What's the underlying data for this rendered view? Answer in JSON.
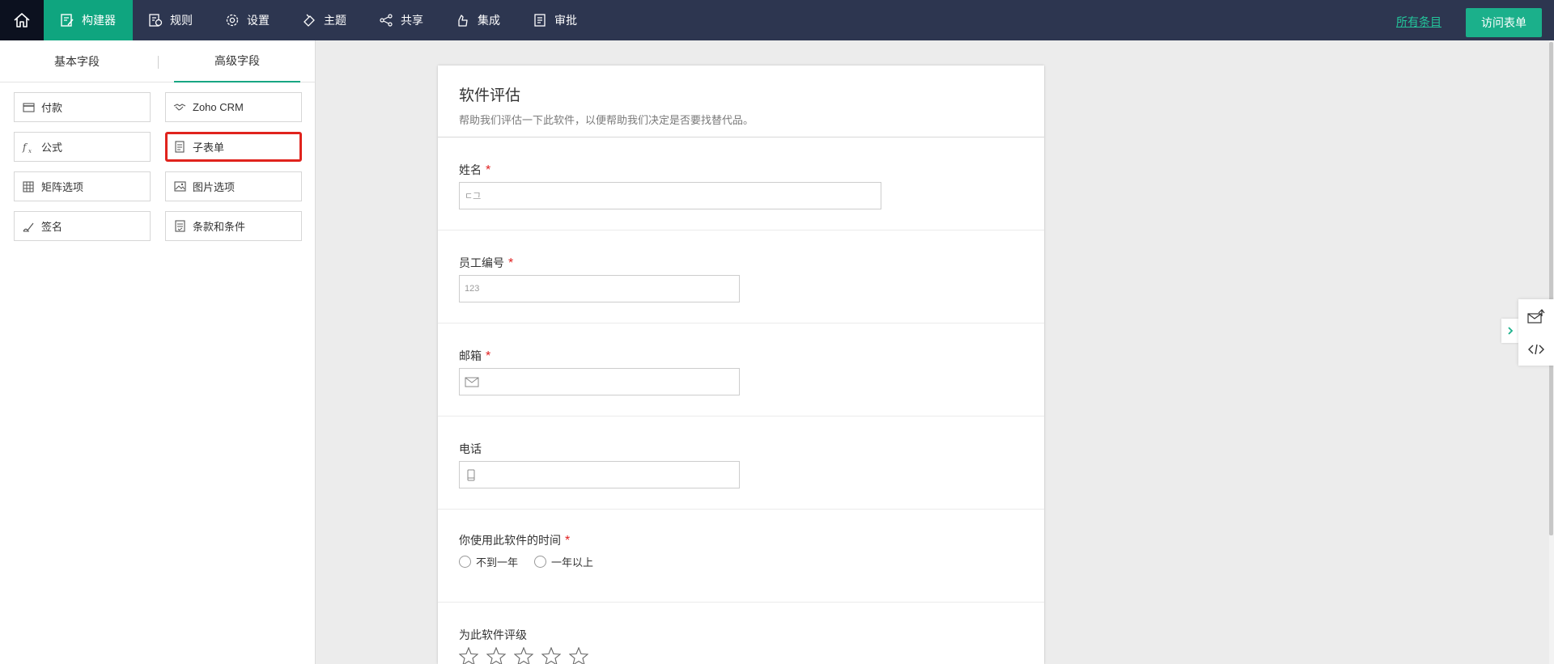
{
  "topbar": {
    "nav": [
      {
        "label": "构建器",
        "icon": "builder-icon",
        "active": true
      },
      {
        "label": "规则",
        "icon": "rules-icon"
      },
      {
        "label": "设置",
        "icon": "settings-icon"
      },
      {
        "label": "主题",
        "icon": "theme-icon"
      },
      {
        "label": "共享",
        "icon": "share-icon"
      },
      {
        "label": "集成",
        "icon": "integration-icon"
      },
      {
        "label": "审批",
        "icon": "approval-icon"
      }
    ],
    "all_entries": "所有条目",
    "access_form": "访问表单"
  },
  "sidebar": {
    "tabs": [
      "基本字段",
      "高级字段"
    ],
    "selected_tab": "高级字段",
    "fields": [
      {
        "label": "付款",
        "icon": "payment-icon"
      },
      {
        "label": "Zoho CRM",
        "icon": "handshake-icon"
      },
      {
        "label": "公式",
        "icon": "formula-icon"
      },
      {
        "label": "子表单",
        "icon": "subform-icon",
        "highlighted": true
      },
      {
        "label": "矩阵选项",
        "icon": "matrix-icon"
      },
      {
        "label": "图片选项",
        "icon": "image-choice-icon"
      },
      {
        "label": "签名",
        "icon": "signature-icon"
      },
      {
        "label": "条款和条件",
        "icon": "terms-icon"
      }
    ]
  },
  "form": {
    "title": "软件评估",
    "description": "帮助我们评估一下此软件，以便帮助我们决定是否要找替代品。",
    "fields": {
      "name": {
        "label": "姓名",
        "required": "*",
        "placeholder": "ㄷ그"
      },
      "employee_no": {
        "label": "员工编号",
        "required": "*",
        "placeholder": "123"
      },
      "email": {
        "label": "邮箱",
        "required": "*"
      },
      "phone": {
        "label": "电话"
      },
      "usage": {
        "label": "你使用此软件的时间",
        "required": "*",
        "options": [
          "不到一年",
          "一年以上"
        ]
      },
      "rating": {
        "label": "为此软件评级",
        "stars": 5
      }
    }
  },
  "colors": {
    "topbar": "#2d3650",
    "active_nav": "#0fa57f",
    "accent": "#1bb08b",
    "highlight_border": "#e0231d",
    "required": "#e02020"
  }
}
